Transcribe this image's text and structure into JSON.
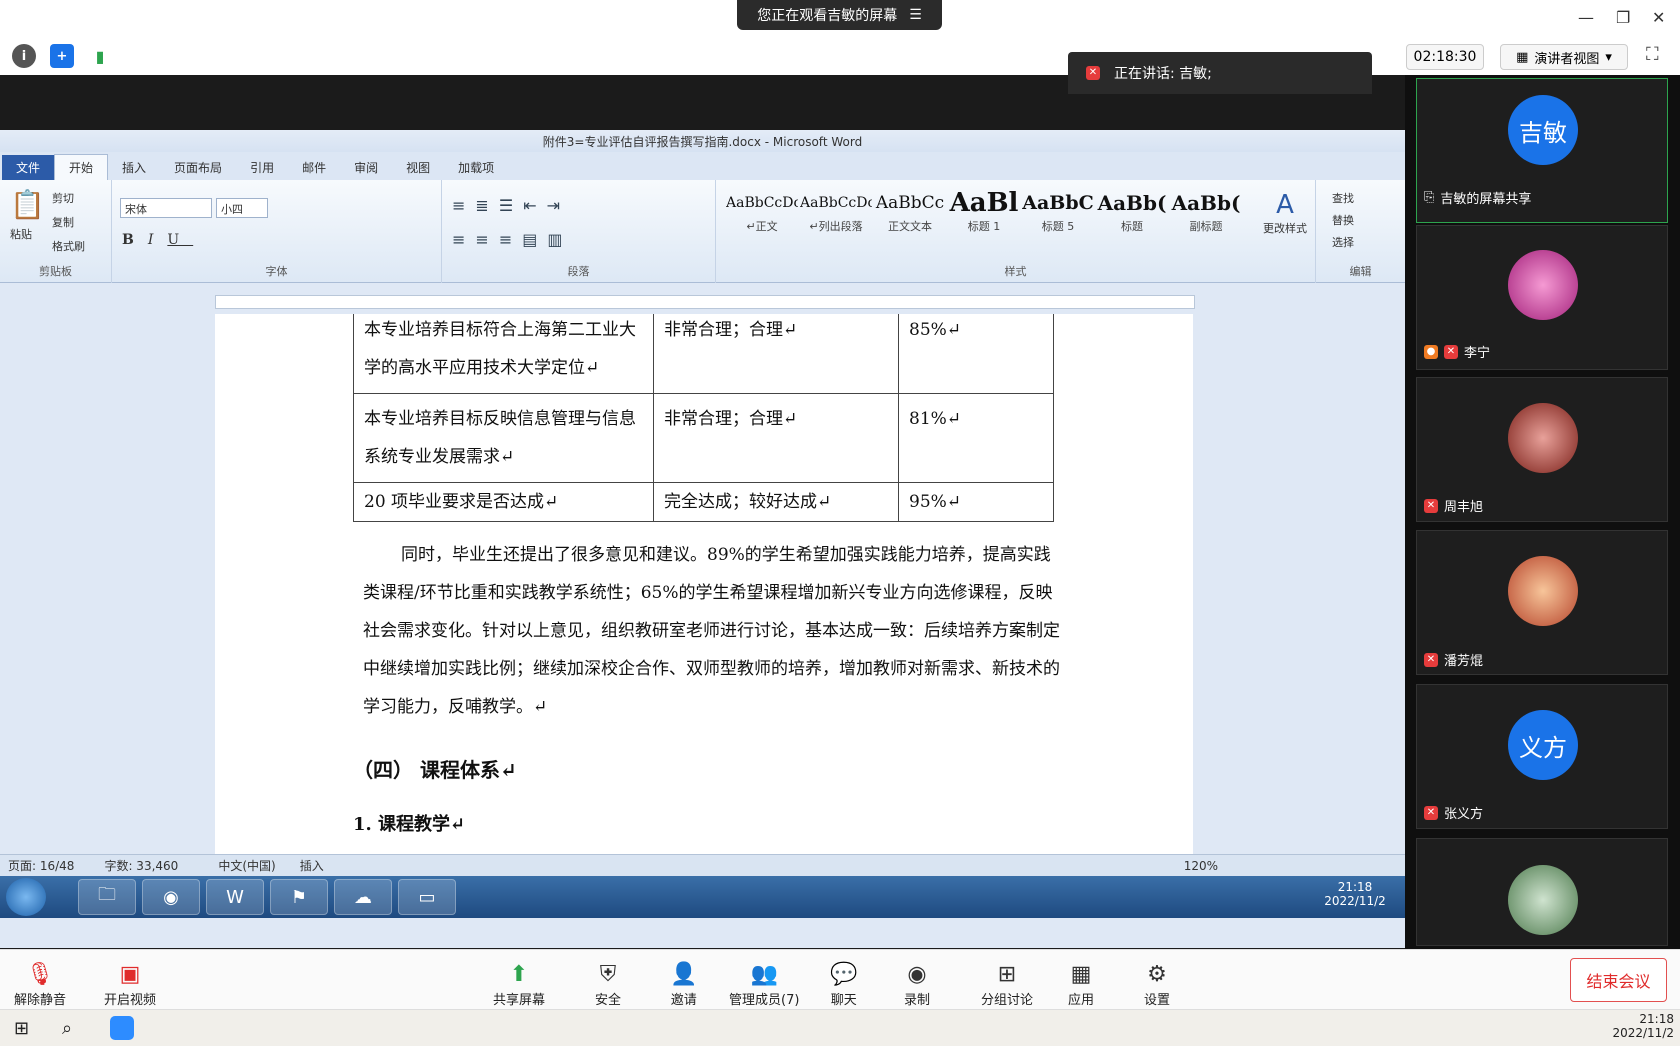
{
  "zoom_top": {
    "banner": "您正在观看吉敏的屏幕",
    "timer": "02:18:30",
    "view_mode": "演讲者视图",
    "speaking": "正在讲话: 吉敏;"
  },
  "word": {
    "title": "附件3=专业评估自评报告撰写指南.docx - Microsoft Word",
    "tabs": [
      "文件",
      "开始",
      "插入",
      "页面布局",
      "引用",
      "邮件",
      "审阅",
      "视图",
      "加载项"
    ],
    "clipboard": {
      "paste": "粘贴",
      "cut": "剪切",
      "copy": "复制",
      "format_painter": "格式刷",
      "label": "剪贴板"
    },
    "font": {
      "name": "宋体",
      "size": "小四",
      "label": "字体"
    },
    "paragraph_label": "段落",
    "styles": [
      {
        "sample": "AaBbCcDc",
        "name": "↵正文"
      },
      {
        "sample": "AaBbCcDc",
        "name": "↵列出段落"
      },
      {
        "sample": "AaBbCc",
        "name": "正文文本"
      },
      {
        "sample": "AaBl",
        "name": "标题 1"
      },
      {
        "sample": "AaBbC",
        "name": "标题 5"
      },
      {
        "sample": "AaBb(",
        "name": "标题"
      },
      {
        "sample": "AaBb(",
        "name": "副标题"
      }
    ],
    "styles_label": "样式",
    "change_styles": "更改样式",
    "editing": {
      "find": "查找",
      "replace": "替换",
      "select": "选择",
      "label": "编辑"
    },
    "table": [
      [
        "本专业培养目标符合上海第二工业大学的高水平应用技术大学定位↵",
        "非常合理；合理↵",
        "85%↵"
      ],
      [
        "本专业培养目标反映信息管理与信息系统专业发展需求↵",
        "非常合理；合理↵",
        "81%↵"
      ],
      [
        "20 项毕业要求是否达成↵",
        "完全达成；较好达成↵",
        "95%↵"
      ]
    ],
    "paragraph": "同时，毕业生还提出了很多意见和建议。89%的学生希望加强实践能力培养，提高实践类课程/环节比重和实践教学系统性；65%的学生希望课程增加新兴专业方向选修课程，反映社会需求变化。针对以上意见，组织教研室老师进行讨论，基本达成一致：后续培养方案制定中继续增加实践比例；继续加深校企合作、双师型教师的培养，增加教师对新需求、新技术的学习能力，反哺教学。↵",
    "heading4": "（四）  课程体系↵",
    "heading1": "1.  课程教学↵",
    "status": {
      "page": "页面: 16/48",
      "words": "字数: 33,460",
      "lang": "中文(中国)",
      "mode": "插入",
      "zoom": "120%"
    },
    "clock_time": "21:18",
    "clock_date": "2022/11/2"
  },
  "participants": [
    {
      "name": "吉敏的屏幕共享",
      "avatar_text": "吉敏",
      "color": "#1a73e8"
    },
    {
      "name": "李宁",
      "avatar_text": "",
      "color": "#c0389a"
    },
    {
      "name": "周丰旭",
      "avatar_text": "",
      "color": "#b33a2e"
    },
    {
      "name": "潘芳焜",
      "avatar_text": "",
      "color": "#d98a4e"
    },
    {
      "name": "张义方",
      "avatar_text": "义方",
      "color": "#1a73e8"
    }
  ],
  "toolbar": {
    "unmute": "解除静音",
    "start_video": "开启视频",
    "share": "共享屏幕",
    "security": "安全",
    "invite": "邀请",
    "manage": "管理成员(7)",
    "chat": "聊天",
    "record": "录制",
    "breakout": "分组讨论",
    "apps": "应用",
    "settings": "设置",
    "end": "结束会议"
  },
  "win_clock": {
    "time": "21:18",
    "date": "2022/11/2"
  }
}
